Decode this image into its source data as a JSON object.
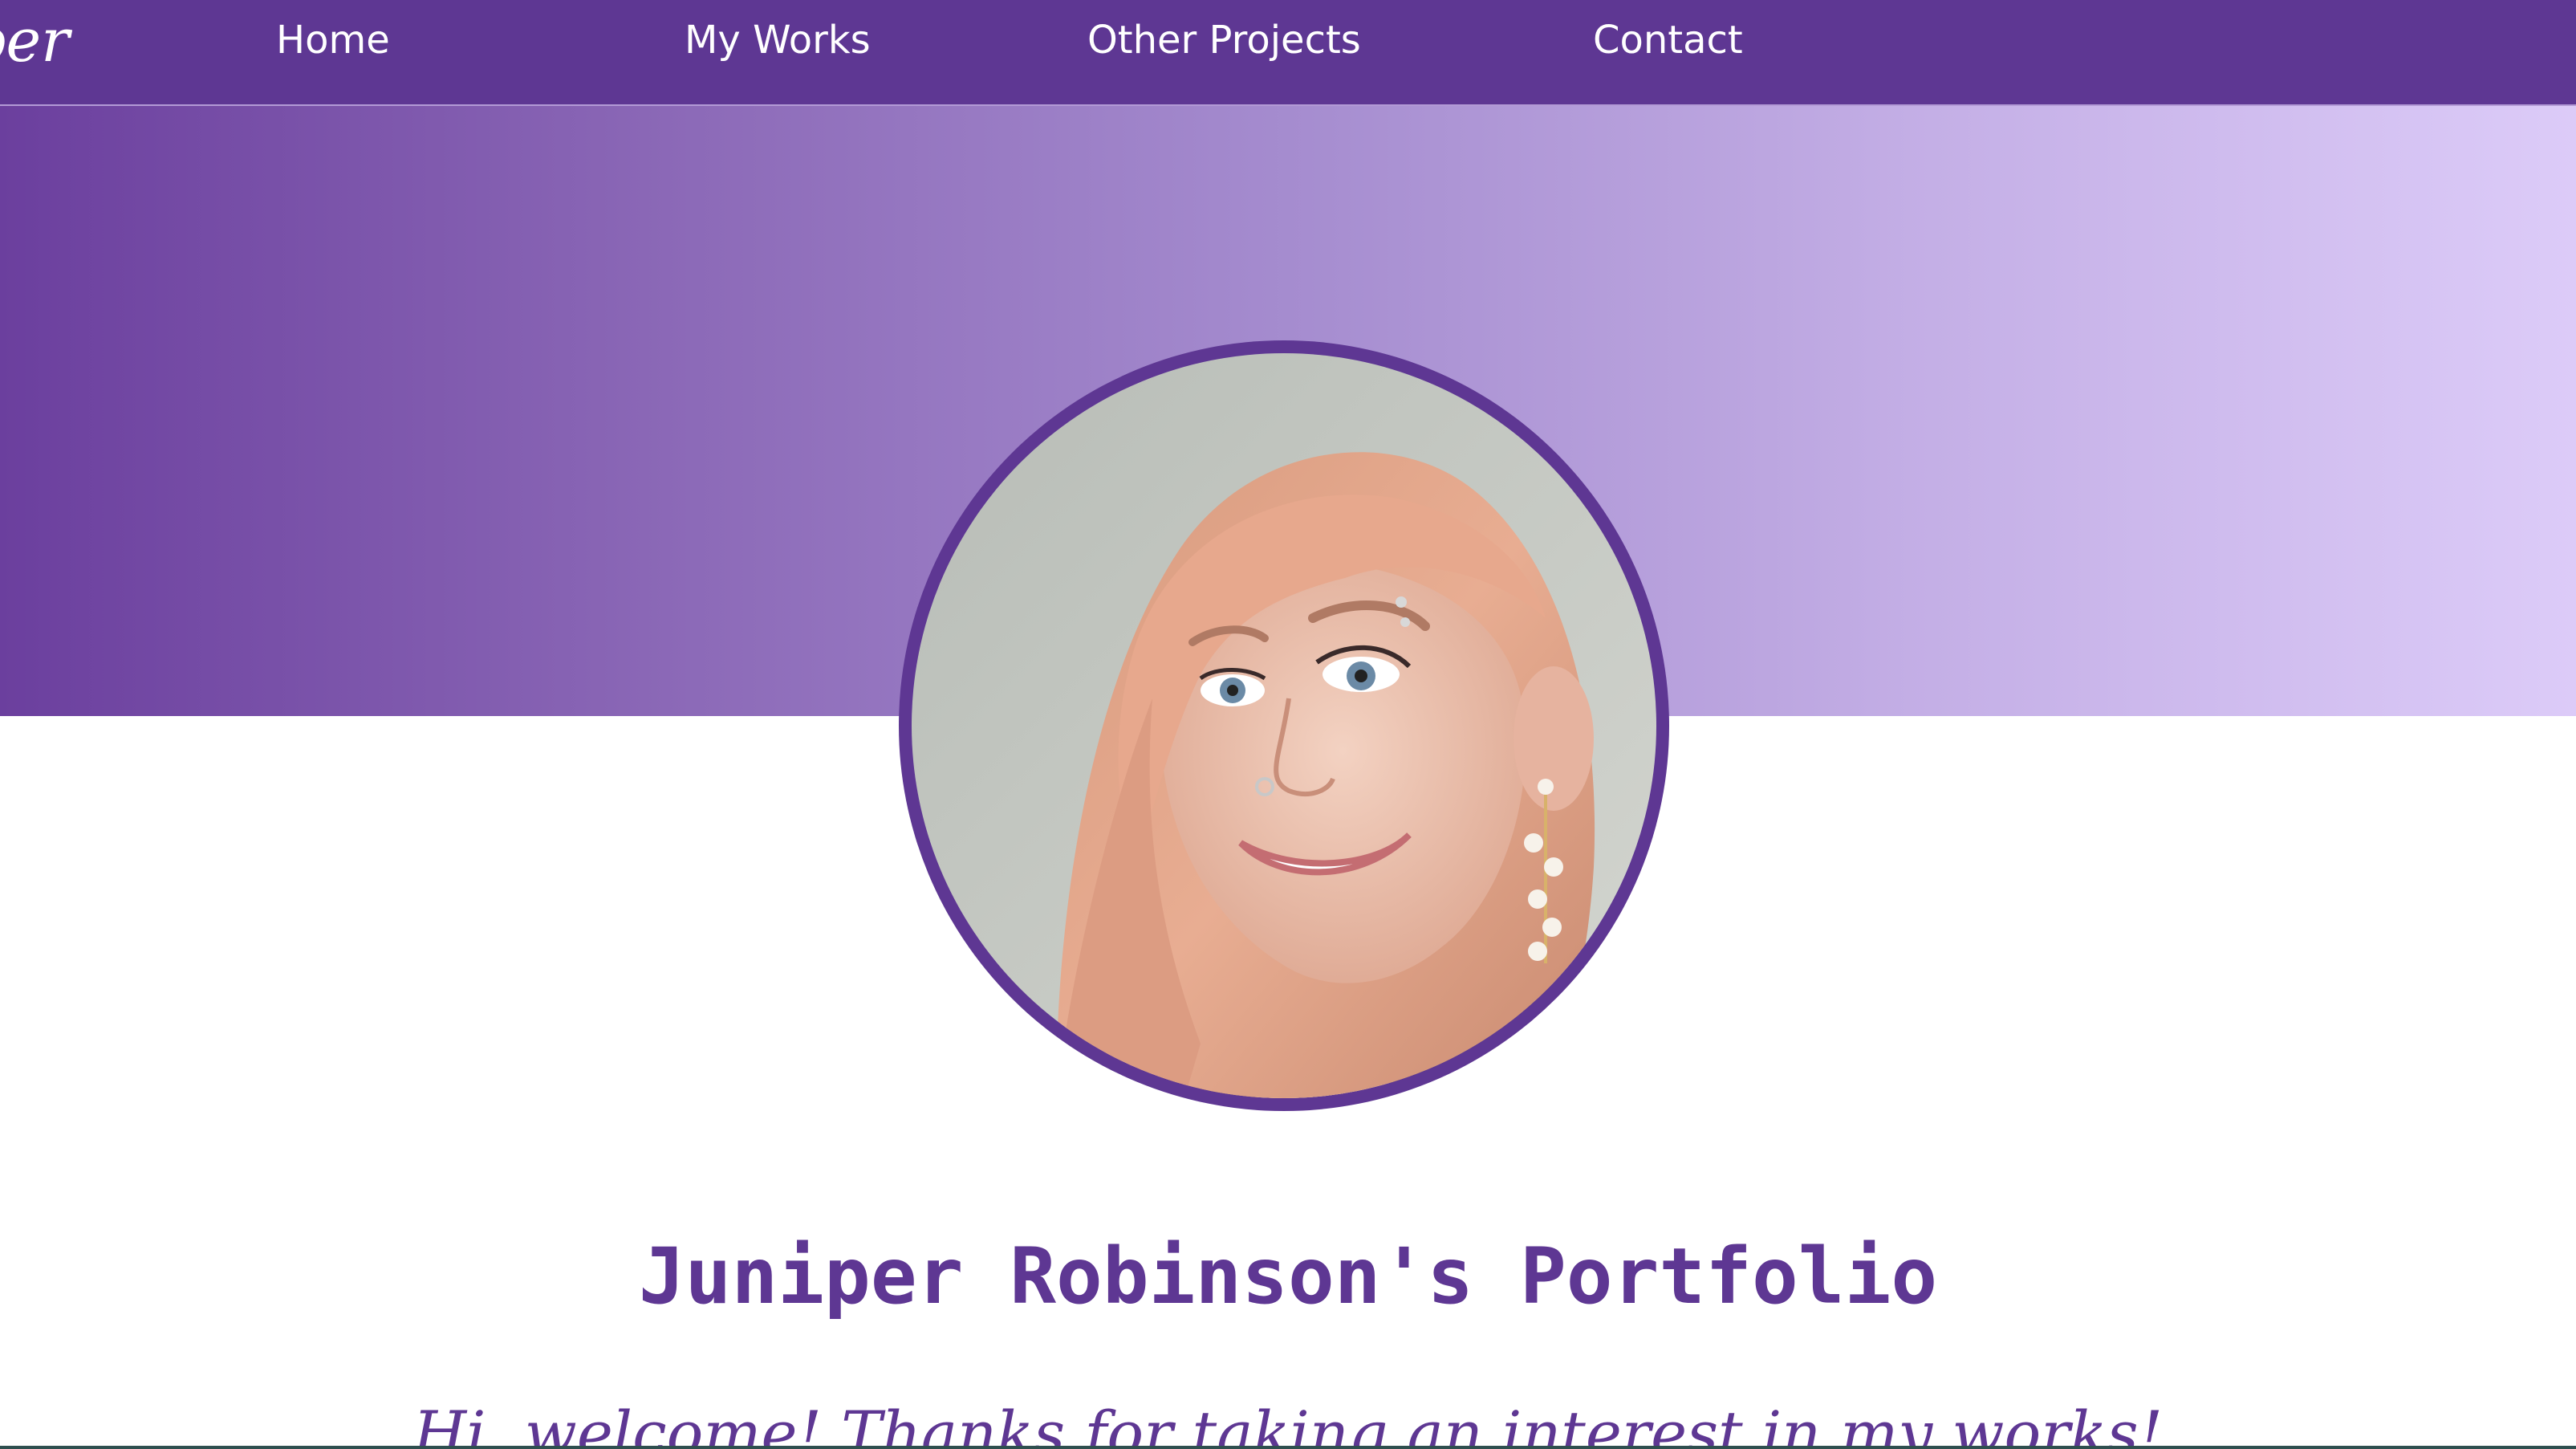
{
  "header": {
    "brand": "per",
    "nav": [
      "Home",
      "My Works",
      "Other Projects",
      "Contact"
    ]
  },
  "profile": {
    "photo_alt": "Profile photo of Juniper Robinson"
  },
  "main": {
    "title": "Juniper Robinson's Portfolio",
    "subtitle": "Hi, welcome! Thanks for taking an interest in my works!"
  },
  "colors": {
    "primary": "#5e3793",
    "gradient_start": "#6b3f9e",
    "gradient_end": "#dccbf8",
    "background": "#ffffff"
  }
}
